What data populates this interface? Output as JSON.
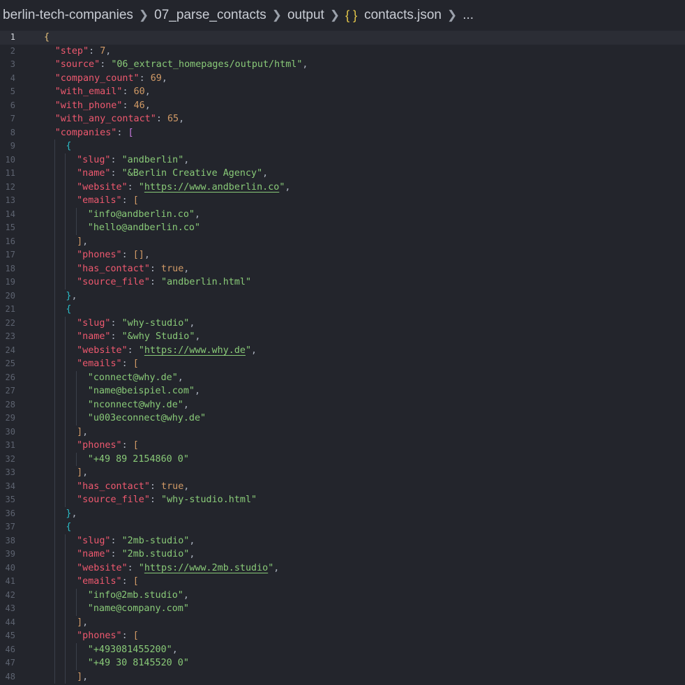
{
  "breadcrumb": [
    "berlin-tech-companies",
    "07_parse_contacts",
    "output",
    "contacts.json",
    "..."
  ],
  "json_icon": "{ }",
  "icons": {
    "separator": "chevron-right-icon",
    "file": "json-braces-icon"
  },
  "colors": {
    "background": "#23252c",
    "key": "#ef596f",
    "string": "#89ca78",
    "number": "#d19a66",
    "bracket_level1": "#e5c07b",
    "bracket_level2": "#c678dd",
    "bracket_level3": "#2bbac5"
  },
  "editor": {
    "active_line": 1,
    "lines": [
      {
        "n": "1",
        "indent": 0,
        "t": [
          [
            "br1",
            "{"
          ]
        ]
      },
      {
        "n": "2",
        "indent": 1,
        "t": [
          [
            "k",
            "\"step\""
          ],
          [
            "p",
            ": "
          ],
          [
            "n",
            "7"
          ],
          [
            "p",
            ","
          ]
        ]
      },
      {
        "n": "3",
        "indent": 1,
        "t": [
          [
            "k",
            "\"source\""
          ],
          [
            "p",
            ": "
          ],
          [
            "s",
            "\"06_extract_homepages/output/html\""
          ],
          [
            "p",
            ","
          ]
        ]
      },
      {
        "n": "4",
        "indent": 1,
        "t": [
          [
            "k",
            "\"company_count\""
          ],
          [
            "p",
            ": "
          ],
          [
            "n",
            "69"
          ],
          [
            "p",
            ","
          ]
        ]
      },
      {
        "n": "5",
        "indent": 1,
        "t": [
          [
            "k",
            "\"with_email\""
          ],
          [
            "p",
            ": "
          ],
          [
            "n",
            "60"
          ],
          [
            "p",
            ","
          ]
        ]
      },
      {
        "n": "6",
        "indent": 1,
        "t": [
          [
            "k",
            "\"with_phone\""
          ],
          [
            "p",
            ": "
          ],
          [
            "n",
            "46"
          ],
          [
            "p",
            ","
          ]
        ]
      },
      {
        "n": "7",
        "indent": 1,
        "t": [
          [
            "k",
            "\"with_any_contact\""
          ],
          [
            "p",
            ": "
          ],
          [
            "n",
            "65"
          ],
          [
            "p",
            ","
          ]
        ]
      },
      {
        "n": "8",
        "indent": 1,
        "t": [
          [
            "k",
            "\"companies\""
          ],
          [
            "p",
            ": "
          ],
          [
            "br2",
            "["
          ]
        ]
      },
      {
        "n": "9",
        "indent": 2,
        "t": [
          [
            "br3",
            "{"
          ]
        ]
      },
      {
        "n": "10",
        "indent": 3,
        "t": [
          [
            "k",
            "\"slug\""
          ],
          [
            "p",
            ": "
          ],
          [
            "s",
            "\"andberlin\""
          ],
          [
            "p",
            ","
          ]
        ]
      },
      {
        "n": "11",
        "indent": 3,
        "t": [
          [
            "k",
            "\"name\""
          ],
          [
            "p",
            ": "
          ],
          [
            "s",
            "\"&Berlin Creative Agency\""
          ],
          [
            "p",
            ","
          ]
        ]
      },
      {
        "n": "12",
        "indent": 3,
        "t": [
          [
            "k",
            "\"website\""
          ],
          [
            "p",
            ": "
          ],
          [
            "s",
            "\""
          ],
          [
            "su",
            "https://www.andberlin.co"
          ],
          [
            "s",
            "\""
          ],
          [
            "p",
            ","
          ]
        ]
      },
      {
        "n": "13",
        "indent": 3,
        "t": [
          [
            "k",
            "\"emails\""
          ],
          [
            "p",
            ": "
          ],
          [
            "b",
            "["
          ]
        ]
      },
      {
        "n": "14",
        "indent": 4,
        "t": [
          [
            "s",
            "\"info@andberlin.co\""
          ],
          [
            "p",
            ","
          ]
        ]
      },
      {
        "n": "15",
        "indent": 4,
        "t": [
          [
            "s",
            "\"hello@andberlin.co\""
          ]
        ]
      },
      {
        "n": "16",
        "indent": 3,
        "t": [
          [
            "b",
            "]"
          ],
          [
            "p",
            ","
          ]
        ]
      },
      {
        "n": "17",
        "indent": 3,
        "t": [
          [
            "k",
            "\"phones\""
          ],
          [
            "p",
            ": "
          ],
          [
            "b",
            "[]"
          ],
          [
            "p",
            ","
          ]
        ]
      },
      {
        "n": "18",
        "indent": 3,
        "t": [
          [
            "k",
            "\"has_contact\""
          ],
          [
            "p",
            ": "
          ],
          [
            "n",
            "true"
          ],
          [
            "p",
            ","
          ]
        ]
      },
      {
        "n": "19",
        "indent": 3,
        "t": [
          [
            "k",
            "\"source_file\""
          ],
          [
            "p",
            ": "
          ],
          [
            "s",
            "\"andberlin.html\""
          ]
        ]
      },
      {
        "n": "20",
        "indent": 2,
        "t": [
          [
            "br3",
            "}"
          ],
          [
            "p",
            ","
          ]
        ]
      },
      {
        "n": "21",
        "indent": 2,
        "t": [
          [
            "br3",
            "{"
          ]
        ]
      },
      {
        "n": "22",
        "indent": 3,
        "t": [
          [
            "k",
            "\"slug\""
          ],
          [
            "p",
            ": "
          ],
          [
            "s",
            "\"why-studio\""
          ],
          [
            "p",
            ","
          ]
        ]
      },
      {
        "n": "23",
        "indent": 3,
        "t": [
          [
            "k",
            "\"name\""
          ],
          [
            "p",
            ": "
          ],
          [
            "s",
            "\"&why Studio\""
          ],
          [
            "p",
            ","
          ]
        ]
      },
      {
        "n": "24",
        "indent": 3,
        "t": [
          [
            "k",
            "\"website\""
          ],
          [
            "p",
            ": "
          ],
          [
            "s",
            "\""
          ],
          [
            "su",
            "https://www.why.de"
          ],
          [
            "s",
            "\""
          ],
          [
            "p",
            ","
          ]
        ]
      },
      {
        "n": "25",
        "indent": 3,
        "t": [
          [
            "k",
            "\"emails\""
          ],
          [
            "p",
            ": "
          ],
          [
            "b",
            "["
          ]
        ]
      },
      {
        "n": "26",
        "indent": 4,
        "t": [
          [
            "s",
            "\"connect@why.de\""
          ],
          [
            "p",
            ","
          ]
        ]
      },
      {
        "n": "27",
        "indent": 4,
        "t": [
          [
            "s",
            "\"name@beispiel.com\""
          ],
          [
            "p",
            ","
          ]
        ]
      },
      {
        "n": "28",
        "indent": 4,
        "t": [
          [
            "s",
            "\"nconnect@why.de\""
          ],
          [
            "p",
            ","
          ]
        ]
      },
      {
        "n": "29",
        "indent": 4,
        "t": [
          [
            "s",
            "\"u003econnect@why.de\""
          ]
        ]
      },
      {
        "n": "30",
        "indent": 3,
        "t": [
          [
            "b",
            "]"
          ],
          [
            "p",
            ","
          ]
        ]
      },
      {
        "n": "31",
        "indent": 3,
        "t": [
          [
            "k",
            "\"phones\""
          ],
          [
            "p",
            ": "
          ],
          [
            "b",
            "["
          ]
        ]
      },
      {
        "n": "32",
        "indent": 4,
        "t": [
          [
            "s",
            "\"+49 89 2154860 0\""
          ]
        ]
      },
      {
        "n": "33",
        "indent": 3,
        "t": [
          [
            "b",
            "]"
          ],
          [
            "p",
            ","
          ]
        ]
      },
      {
        "n": "34",
        "indent": 3,
        "t": [
          [
            "k",
            "\"has_contact\""
          ],
          [
            "p",
            ": "
          ],
          [
            "n",
            "true"
          ],
          [
            "p",
            ","
          ]
        ]
      },
      {
        "n": "35",
        "indent": 3,
        "t": [
          [
            "k",
            "\"source_file\""
          ],
          [
            "p",
            ": "
          ],
          [
            "s",
            "\"why-studio.html\""
          ]
        ]
      },
      {
        "n": "36",
        "indent": 2,
        "t": [
          [
            "br3",
            "}"
          ],
          [
            "p",
            ","
          ]
        ]
      },
      {
        "n": "37",
        "indent": 2,
        "t": [
          [
            "br3",
            "{"
          ]
        ]
      },
      {
        "n": "38",
        "indent": 3,
        "t": [
          [
            "k",
            "\"slug\""
          ],
          [
            "p",
            ": "
          ],
          [
            "s",
            "\"2mb-studio\""
          ],
          [
            "p",
            ","
          ]
        ]
      },
      {
        "n": "39",
        "indent": 3,
        "t": [
          [
            "k",
            "\"name\""
          ],
          [
            "p",
            ": "
          ],
          [
            "s",
            "\"2mb.studio\""
          ],
          [
            "p",
            ","
          ]
        ]
      },
      {
        "n": "40",
        "indent": 3,
        "t": [
          [
            "k",
            "\"website\""
          ],
          [
            "p",
            ": "
          ],
          [
            "s",
            "\""
          ],
          [
            "su",
            "https://www.2mb.studio"
          ],
          [
            "s",
            "\""
          ],
          [
            "p",
            ","
          ]
        ]
      },
      {
        "n": "41",
        "indent": 3,
        "t": [
          [
            "k",
            "\"emails\""
          ],
          [
            "p",
            ": "
          ],
          [
            "b",
            "["
          ]
        ]
      },
      {
        "n": "42",
        "indent": 4,
        "t": [
          [
            "s",
            "\"info@2mb.studio\""
          ],
          [
            "p",
            ","
          ]
        ]
      },
      {
        "n": "43",
        "indent": 4,
        "t": [
          [
            "s",
            "\"name@company.com\""
          ]
        ]
      },
      {
        "n": "44",
        "indent": 3,
        "t": [
          [
            "b",
            "]"
          ],
          [
            "p",
            ","
          ]
        ]
      },
      {
        "n": "45",
        "indent": 3,
        "t": [
          [
            "k",
            "\"phones\""
          ],
          [
            "p",
            ": "
          ],
          [
            "b",
            "["
          ]
        ]
      },
      {
        "n": "46",
        "indent": 4,
        "t": [
          [
            "s",
            "\"+493081455200\""
          ],
          [
            "p",
            ","
          ]
        ]
      },
      {
        "n": "47",
        "indent": 4,
        "t": [
          [
            "s",
            "\"+49 30 8145520 0\""
          ]
        ]
      },
      {
        "n": "48",
        "indent": 3,
        "t": [
          [
            "b",
            "]"
          ],
          [
            "p",
            ","
          ]
        ]
      }
    ]
  }
}
